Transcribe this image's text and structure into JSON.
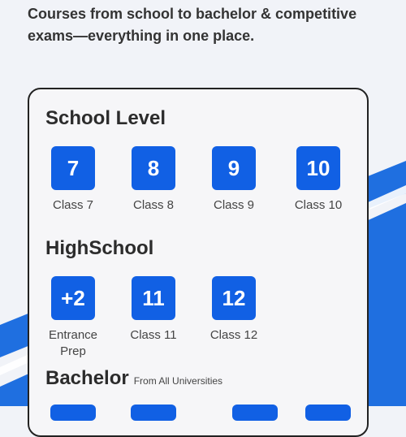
{
  "headline": "Courses from school to bachelor & competitive exams—everything in one place.",
  "school": {
    "title": "School Level",
    "items": [
      {
        "badge": "7",
        "label": "Class 7"
      },
      {
        "badge": "8",
        "label": "Class 8"
      },
      {
        "badge": "9",
        "label": "Class 9"
      },
      {
        "badge": "10",
        "label": "Class 10"
      }
    ]
  },
  "highschool": {
    "title": "HighSchool",
    "items": [
      {
        "badge": "+2",
        "label": "Entrance Prep"
      },
      {
        "badge": "11",
        "label": "Class 11"
      },
      {
        "badge": "12",
        "label": "Class 12"
      }
    ]
  },
  "bachelor": {
    "title": "Bachelor",
    "subtitle": "From All Universities"
  },
  "colors": {
    "accent": "#1160e4",
    "stripe": "#1f6fe0",
    "background": "#f1f3f8"
  }
}
